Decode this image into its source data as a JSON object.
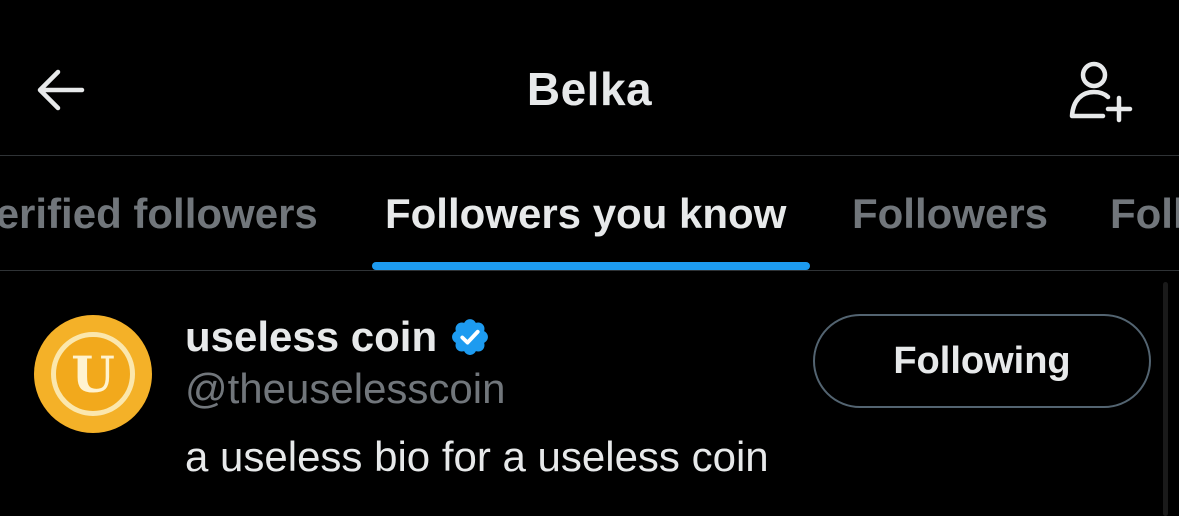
{
  "header": {
    "title": "Belka",
    "back_icon": "arrow-left-icon",
    "add_user_icon": "person-add-icon"
  },
  "tabs": [
    {
      "label": "Verified followers",
      "active": false
    },
    {
      "label": "Followers you know",
      "active": true
    },
    {
      "label": "Followers",
      "active": false
    },
    {
      "label": "Following",
      "active": false
    }
  ],
  "users": [
    {
      "display_name": "useless coin",
      "handle": "@theuselesscoin",
      "bio": "a useless bio for a useless coin",
      "verified": true,
      "avatar_letter": "U",
      "button_label": "Following"
    }
  ],
  "colors": {
    "background": "#000000",
    "accent": "#1d9bf0",
    "text_primary": "#e7e9ea",
    "text_secondary": "#71767b",
    "divider": "#2f3336",
    "avatar": "#f4b128"
  }
}
